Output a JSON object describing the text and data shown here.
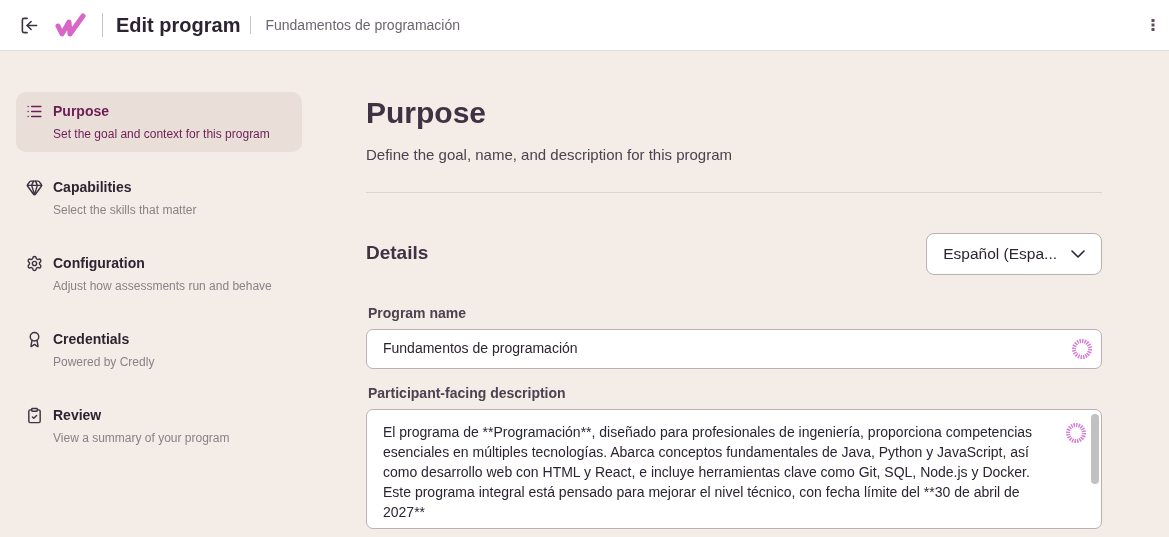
{
  "header": {
    "title": "Edit program",
    "subtitle": "Fundamentos de programación"
  },
  "sidebar": {
    "items": [
      {
        "kind": "list",
        "label": "Purpose",
        "description": "Set the goal and context for this program",
        "selected": true
      },
      {
        "kind": "gem",
        "label": "Capabilities",
        "description": "Select the skills that matter",
        "selected": false
      },
      {
        "kind": "gear",
        "label": "Configuration",
        "description": "Adjust how assessments run and behave",
        "selected": false
      },
      {
        "kind": "award",
        "label": "Credentials",
        "description": "Powered by Credly",
        "selected": false
      },
      {
        "kind": "clipboard",
        "label": "Review",
        "description": "View a summary of your program",
        "selected": false
      }
    ]
  },
  "page": {
    "title": "Purpose",
    "subtitle": "Define the goal, name, and description for this program"
  },
  "details": {
    "title": "Details",
    "language": "Español (Espa...",
    "program_name": {
      "label": "Program name",
      "value": "Fundamentos de programación"
    },
    "description": {
      "label": "Participant-facing description",
      "value": "El programa de **Programación**, diseñado para profesionales de ingeniería, proporciona competencias esenciales en múltiples tecnologías. Abarca conceptos fundamentales de Java, Python y JavaScript, así como desarrollo web con HTML y React, e incluye herramientas clave como Git, SQL, Node.js y Docker. Este programa integral está pensado para mejorar el nivel técnico, con fecha límite del **30 de abril de 2027**"
    }
  }
}
